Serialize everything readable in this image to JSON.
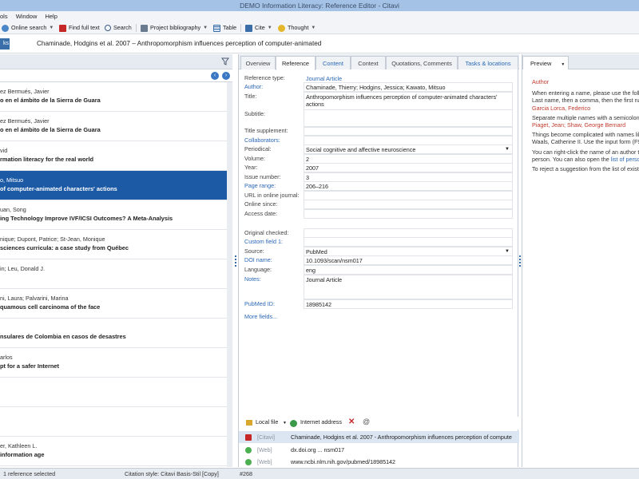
{
  "window": {
    "title": "DEMO Information Literacy: Reference Editor - Citavi"
  },
  "menu": [
    "ols",
    "Window",
    "Help"
  ],
  "toolbar": {
    "online_search": "Online search",
    "find_full_text": "Find full text",
    "search": "Search",
    "project_bibliography": "Project bibliography",
    "table": "Table",
    "cite": "Cite",
    "thought": "Thought"
  },
  "refbar": {
    "tasks_label": "ks",
    "title": "Chaminade, Hodgins et al. 2007 – Anthropomorphism influences perception of computer-animated"
  },
  "references": [
    {
      "authors": "ez Bermués, Javier",
      "title": "o en el ámbito de la Sierra de Guara",
      "selected": false
    },
    {
      "authors": "ez Bermués, Javier",
      "title": "o en el ámbito de la Sierra de Guara",
      "selected": false
    },
    {
      "authors": "vid",
      "title": "rmation literacy for the real world",
      "selected": false
    },
    {
      "authors": "o, Mitsuo",
      "title": "of computer-animated characters' actions",
      "selected": true
    },
    {
      "authors": "uan, Song",
      "title": "ing Technology Improve IVF/ICSI Outcomes? A Meta-Analysis",
      "selected": false
    },
    {
      "authors": "nique; Dupont, Patrice; St-Jean, Monique",
      "title": "sciences curricula: a case study from Québec",
      "selected": false
    },
    {
      "authors": "in; Leu, Donald J.",
      "title": "",
      "selected": false
    },
    {
      "authors": "ni, Laura; Palvarini, Marina",
      "title": "quamous cell carcinoma of the face",
      "selected": false
    },
    {
      "authors": "",
      "title": "nsulares de Colombia en casos de desastres",
      "selected": false
    },
    {
      "authors": "arlos",
      "title": "pt for a safer Internet",
      "selected": false
    },
    {
      "authors": "",
      "title": "",
      "selected": false
    },
    {
      "authors": "",
      "title": "",
      "selected": false
    },
    {
      "authors": "er, Kathleen L.",
      "title": " information age",
      "selected": false
    }
  ],
  "tabs": [
    "Overview",
    "Reference",
    "Content",
    "Context",
    "Quotations, Comments",
    "Tasks & locations"
  ],
  "fields": [
    {
      "label": "Reference type:",
      "value": "Journal Article",
      "label_link": false,
      "value_link": true
    },
    {
      "label": "Author:",
      "value": "Chaminade, Thierry; Hodgins, Jessica; Kawato, Mitsuo",
      "label_link": true
    },
    {
      "label": "Title:",
      "value": "Anthropomorphism influences perception of computer-animated characters' actions"
    },
    {
      "label": "Subtitle:",
      "value": ""
    },
    {
      "label": "Title supplement:",
      "value": ""
    },
    {
      "label": "Collaborators:",
      "value": "",
      "label_link": true
    },
    {
      "label": "Periodical:",
      "value": "Social cognitive and affective neuroscience"
    },
    {
      "label": "Volume:",
      "value": "2"
    },
    {
      "label": "Year:",
      "value": "2007"
    },
    {
      "label": "Issue number:",
      "value": "3"
    },
    {
      "label": "Page range:",
      "value": "206–216",
      "label_link": true
    },
    {
      "label": "URL in online journal:",
      "value": ""
    },
    {
      "label": "Online since:",
      "value": ""
    },
    {
      "label": "Access date:",
      "value": ""
    },
    {
      "label": "Original checked:",
      "value": ""
    },
    {
      "label": "Custom field 1:",
      "value": "",
      "label_link": true
    },
    {
      "label": "Source:",
      "value": "PubMed"
    },
    {
      "label": "DOI name:",
      "value": "10.1093/scan/nsm017",
      "label_link": true
    },
    {
      "label": "Language:",
      "value": "eng"
    },
    {
      "label": "Notes:",
      "value": "Journal Article",
      "label_link": true
    },
    {
      "label": "PubMed ID:",
      "value": "18985142",
      "label_link": true
    }
  ],
  "more_fields": "More fields...",
  "attachments_toolbar": {
    "local_file": "Local file",
    "internet_address": "Internet address"
  },
  "attachments": [
    {
      "source": "[Citavi]",
      "text": "Chaminade, Hodgins et al. 2007 - Anthropomorphism influences perception of compute",
      "selected": true
    },
    {
      "source": "[Web]",
      "text": "dx.doi.org ... nsm017",
      "selected": false
    },
    {
      "source": "[Web]",
      "text": "www.ncbi.nlm.nih.gov/pubmed/18985142",
      "selected": false
    }
  ],
  "preview": {
    "tab_label": "Preview",
    "heading": "Author",
    "line1": "When entering a name, please use the follow",
    "line2": "Last name, then a comma, then the first nam",
    "example1": "Garcia Lorca, Federico",
    "line3": "Separate multiple names with a semicolon:",
    "example2": "Piaget, Jean; Shaw, George Bernard",
    "line4": "Things become complicated with names like",
    "line5": "Waals, Catherine II. Use the input form (F9 or",
    "line6": "You can right-click the name of an author to",
    "line7a": "person. You can also open the ",
    "line7b": "list of persons",
    "line8": "To reject a suggestion from the list of existin"
  },
  "status": {
    "selection": "1 reference selected",
    "citation_style": "Citation style: Citavi Basis-Stil [Copy]",
    "count": "#268"
  },
  "colors": {
    "accent": "#1c5aa6",
    "link": "#2a68b6",
    "preview_red": "#c0392b",
    "title_bar": "#a3c2e6"
  }
}
